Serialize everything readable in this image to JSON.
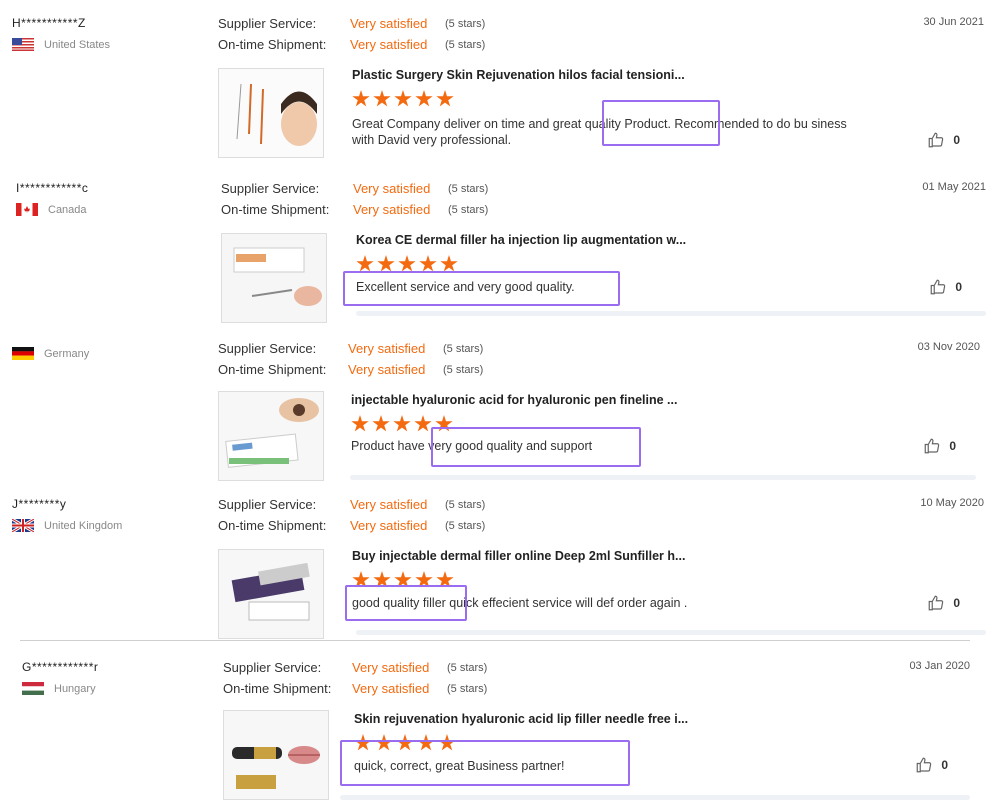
{
  "labels": {
    "supplier_service": "Supplier Service:",
    "ontime_shipment": "On-time Shipment:"
  },
  "reviews": [
    {
      "buyer": "H***********Z",
      "country": "United States",
      "flag_icon": "flag-us-icon",
      "supplier_rating": "Very satisfied",
      "supplier_stars": "(5 stars)",
      "shipment_rating": "Very satisfied",
      "shipment_stars": "(5 stars)",
      "date": "30 Jun 2021",
      "product_title": "Plastic Surgery Skin Rejuvenation hilos facial tensioni...",
      "stars": 5,
      "comment": "Great Company deliver on time and great quality Product. Recommended to do bu siness with David very professional.",
      "likes": "0"
    },
    {
      "buyer": "I************c",
      "country": "Canada",
      "flag_icon": "flag-ca-icon",
      "supplier_rating": "Very satisfied",
      "supplier_stars": "(5 stars)",
      "shipment_rating": "Very satisfied",
      "shipment_stars": "(5 stars)",
      "date": "01 May 2021",
      "product_title": "Korea CE dermal filler ha injection lip augmentation w...",
      "stars": 5,
      "comment": "Excellent service and very good quality.",
      "likes": "0"
    },
    {
      "buyer": "",
      "country": "Germany",
      "flag_icon": "flag-de-icon",
      "supplier_rating": "Very satisfied",
      "supplier_stars": "(5 stars)",
      "shipment_rating": "Very satisfied",
      "shipment_stars": "(5 stars)",
      "date": "03 Nov 2020",
      "product_title": "injectable hyaluronic acid for hyaluronic pen fineline ...",
      "stars": 5,
      "comment": "Product have very good quality and support",
      "likes": "0"
    },
    {
      "buyer": "J********y",
      "country": "United Kingdom",
      "flag_icon": "flag-uk-icon",
      "supplier_rating": "Very satisfied",
      "supplier_stars": "(5 stars)",
      "shipment_rating": "Very satisfied",
      "shipment_stars": "(5 stars)",
      "date": "10 May 2020",
      "product_title": "Buy injectable dermal filler online Deep 2ml Sunfiller h...",
      "stars": 5,
      "comment": "good quality filler  quick effecient service will def order again .",
      "likes": "0"
    },
    {
      "buyer": "G************r",
      "country": "Hungary",
      "flag_icon": "flag-hu-icon",
      "supplier_rating": "Very satisfied",
      "supplier_stars": "(5 stars)",
      "shipment_rating": "Very satisfied",
      "shipment_stars": "(5 stars)",
      "date": "03 Jan 2020",
      "product_title": "Skin rejuvenation hyaluronic acid lip filler needle free i...",
      "stars": 5,
      "comment": "quick, correct, great Business partner!",
      "likes": "0"
    }
  ],
  "colors": {
    "accent": "#f36a10",
    "highlight": "#9a6cf0"
  }
}
